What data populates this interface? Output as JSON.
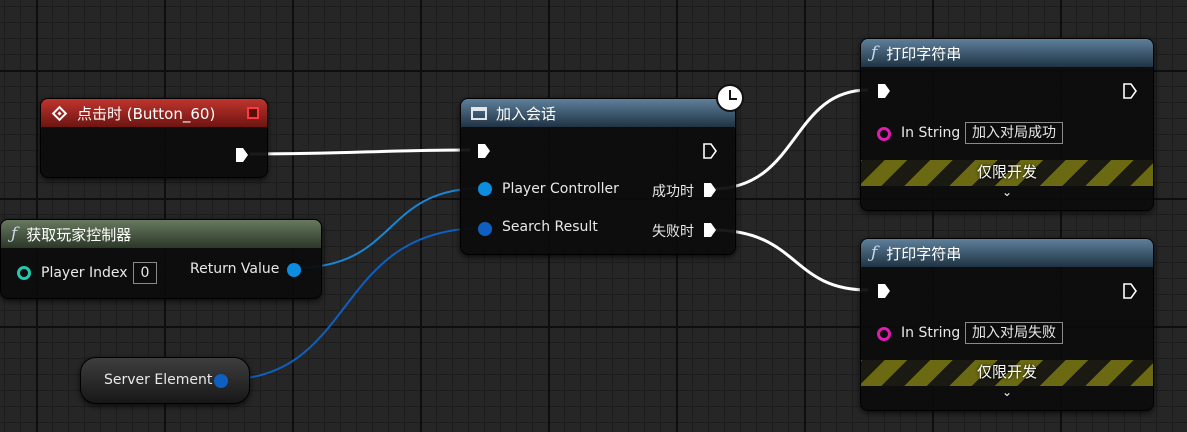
{
  "nodes": {
    "on_clicked": {
      "title": "点击时 (Button_60)"
    },
    "get_player_controller": {
      "title": "获取玩家控制器",
      "player_index_label": "Player Index",
      "player_index_value": "0",
      "return_value_label": "Return Value"
    },
    "join_session": {
      "title": "加入会话",
      "player_controller_label": "Player Controller",
      "search_result_label": "Search Result",
      "on_success_label": "成功时",
      "on_failure_label": "失败时"
    },
    "server_element": {
      "label": "Server Element"
    },
    "print_success": {
      "title": "打印字符串",
      "in_string_label": "In String",
      "in_string_value": "加入对局成功",
      "dev_only_label": "仅限开发",
      "expand_glyph": "⌄"
    },
    "print_failure": {
      "title": "打印字符串",
      "in_string_label": "In String",
      "in_string_value": "加入对局失败",
      "dev_only_label": "仅限开发",
      "expand_glyph": "⌄"
    }
  },
  "colors": {
    "exec_wire": "#ffffff",
    "struct_pin": "#0c8de0",
    "int_pin": "#20c9b0",
    "string_pin": "#e01cb0",
    "event_header": "#b02a26",
    "pure_func_header": "#5e7256",
    "func_header": "#4f6f8c"
  },
  "icons": {
    "function": "function-icon",
    "event": "event-diamond-icon",
    "latent": "clock-icon",
    "macro": "window-icon"
  }
}
